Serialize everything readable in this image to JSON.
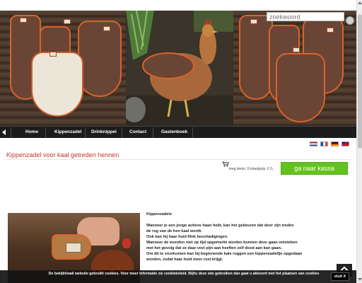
{
  "search": {
    "placeholder": "zoekwoord",
    "icon": "search-icon"
  },
  "nav": {
    "items": [
      {
        "label": "Home"
      },
      {
        "label": "Kippenzadel"
      },
      {
        "label": "Drinknippel"
      },
      {
        "label": "Contact"
      },
      {
        "label": "Gastenboek"
      }
    ]
  },
  "languages": [
    {
      "code": "nl",
      "icon": "dutch-flag-icon"
    },
    {
      "code": "fr",
      "icon": "french-flag-icon"
    },
    {
      "code": "de",
      "icon": "german-flag-icon"
    },
    {
      "code": "en",
      "icon": "uk-flag-icon"
    }
  ],
  "page": {
    "title": "Kippenzadel voor kaal getreden hennen"
  },
  "cart": {
    "status": "leeg items: 0 totaalprijs: € 0,-",
    "checkout_label": "ga naar kassa"
  },
  "description": {
    "heading": "Kippenzadels",
    "lines": [
      "Wanneer je een jonge actieve haan hebt, kan het gebeuren dat door zijn treden",
      "de rug van de hen kaal wordt.",
      "Ook kan hij haar huid flink beschadigingen.",
      "Wanneer de wonden niet op tijd opgemerkt worden kunnen deze gaan ontsteken",
      "met het gevolg dat ze daar veel pijn aan heeften zelf dood aan kan gaan.",
      "Om dit te voorkomen kan bij beginnende kale ruggen een kippenzadeltje opgedaan",
      "worden, zodat haar huid meer rust krijgt."
    ]
  },
  "cookie": {
    "message": "De bekijkt/wall website gebruikt cookies. Voor meer informatie zie cookiebeleid. Bij/tu deze site gebruiken dan gaat u akkoord met het plaatsen van cookies",
    "close_label": "sluit X"
  },
  "colors": {
    "title": "#c0392b",
    "checkout": "#63c21f",
    "nav": "#1c1c1c"
  }
}
